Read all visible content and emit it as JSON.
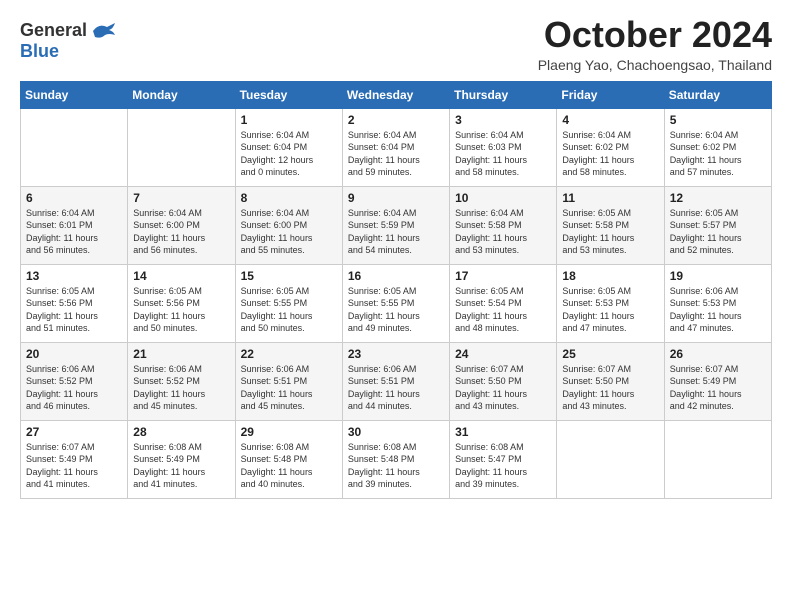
{
  "logo": {
    "general": "General",
    "blue": "Blue"
  },
  "title": "October 2024",
  "subtitle": "Plaeng Yao, Chachoengsao, Thailand",
  "days_of_week": [
    "Sunday",
    "Monday",
    "Tuesday",
    "Wednesday",
    "Thursday",
    "Friday",
    "Saturday"
  ],
  "weeks": [
    [
      {
        "day": "",
        "info": ""
      },
      {
        "day": "",
        "info": ""
      },
      {
        "day": "1",
        "info": "Sunrise: 6:04 AM\nSunset: 6:04 PM\nDaylight: 12 hours\nand 0 minutes."
      },
      {
        "day": "2",
        "info": "Sunrise: 6:04 AM\nSunset: 6:04 PM\nDaylight: 11 hours\nand 59 minutes."
      },
      {
        "day": "3",
        "info": "Sunrise: 6:04 AM\nSunset: 6:03 PM\nDaylight: 11 hours\nand 58 minutes."
      },
      {
        "day": "4",
        "info": "Sunrise: 6:04 AM\nSunset: 6:02 PM\nDaylight: 11 hours\nand 58 minutes."
      },
      {
        "day": "5",
        "info": "Sunrise: 6:04 AM\nSunset: 6:02 PM\nDaylight: 11 hours\nand 57 minutes."
      }
    ],
    [
      {
        "day": "6",
        "info": "Sunrise: 6:04 AM\nSunset: 6:01 PM\nDaylight: 11 hours\nand 56 minutes."
      },
      {
        "day": "7",
        "info": "Sunrise: 6:04 AM\nSunset: 6:00 PM\nDaylight: 11 hours\nand 56 minutes."
      },
      {
        "day": "8",
        "info": "Sunrise: 6:04 AM\nSunset: 6:00 PM\nDaylight: 11 hours\nand 55 minutes."
      },
      {
        "day": "9",
        "info": "Sunrise: 6:04 AM\nSunset: 5:59 PM\nDaylight: 11 hours\nand 54 minutes."
      },
      {
        "day": "10",
        "info": "Sunrise: 6:04 AM\nSunset: 5:58 PM\nDaylight: 11 hours\nand 53 minutes."
      },
      {
        "day": "11",
        "info": "Sunrise: 6:05 AM\nSunset: 5:58 PM\nDaylight: 11 hours\nand 53 minutes."
      },
      {
        "day": "12",
        "info": "Sunrise: 6:05 AM\nSunset: 5:57 PM\nDaylight: 11 hours\nand 52 minutes."
      }
    ],
    [
      {
        "day": "13",
        "info": "Sunrise: 6:05 AM\nSunset: 5:56 PM\nDaylight: 11 hours\nand 51 minutes."
      },
      {
        "day": "14",
        "info": "Sunrise: 6:05 AM\nSunset: 5:56 PM\nDaylight: 11 hours\nand 50 minutes."
      },
      {
        "day": "15",
        "info": "Sunrise: 6:05 AM\nSunset: 5:55 PM\nDaylight: 11 hours\nand 50 minutes."
      },
      {
        "day": "16",
        "info": "Sunrise: 6:05 AM\nSunset: 5:55 PM\nDaylight: 11 hours\nand 49 minutes."
      },
      {
        "day": "17",
        "info": "Sunrise: 6:05 AM\nSunset: 5:54 PM\nDaylight: 11 hours\nand 48 minutes."
      },
      {
        "day": "18",
        "info": "Sunrise: 6:05 AM\nSunset: 5:53 PM\nDaylight: 11 hours\nand 47 minutes."
      },
      {
        "day": "19",
        "info": "Sunrise: 6:06 AM\nSunset: 5:53 PM\nDaylight: 11 hours\nand 47 minutes."
      }
    ],
    [
      {
        "day": "20",
        "info": "Sunrise: 6:06 AM\nSunset: 5:52 PM\nDaylight: 11 hours\nand 46 minutes."
      },
      {
        "day": "21",
        "info": "Sunrise: 6:06 AM\nSunset: 5:52 PM\nDaylight: 11 hours\nand 45 minutes."
      },
      {
        "day": "22",
        "info": "Sunrise: 6:06 AM\nSunset: 5:51 PM\nDaylight: 11 hours\nand 45 minutes."
      },
      {
        "day": "23",
        "info": "Sunrise: 6:06 AM\nSunset: 5:51 PM\nDaylight: 11 hours\nand 44 minutes."
      },
      {
        "day": "24",
        "info": "Sunrise: 6:07 AM\nSunset: 5:50 PM\nDaylight: 11 hours\nand 43 minutes."
      },
      {
        "day": "25",
        "info": "Sunrise: 6:07 AM\nSunset: 5:50 PM\nDaylight: 11 hours\nand 43 minutes."
      },
      {
        "day": "26",
        "info": "Sunrise: 6:07 AM\nSunset: 5:49 PM\nDaylight: 11 hours\nand 42 minutes."
      }
    ],
    [
      {
        "day": "27",
        "info": "Sunrise: 6:07 AM\nSunset: 5:49 PM\nDaylight: 11 hours\nand 41 minutes."
      },
      {
        "day": "28",
        "info": "Sunrise: 6:08 AM\nSunset: 5:49 PM\nDaylight: 11 hours\nand 41 minutes."
      },
      {
        "day": "29",
        "info": "Sunrise: 6:08 AM\nSunset: 5:48 PM\nDaylight: 11 hours\nand 40 minutes."
      },
      {
        "day": "30",
        "info": "Sunrise: 6:08 AM\nSunset: 5:48 PM\nDaylight: 11 hours\nand 39 minutes."
      },
      {
        "day": "31",
        "info": "Sunrise: 6:08 AM\nSunset: 5:47 PM\nDaylight: 11 hours\nand 39 minutes."
      },
      {
        "day": "",
        "info": ""
      },
      {
        "day": "",
        "info": ""
      }
    ]
  ]
}
